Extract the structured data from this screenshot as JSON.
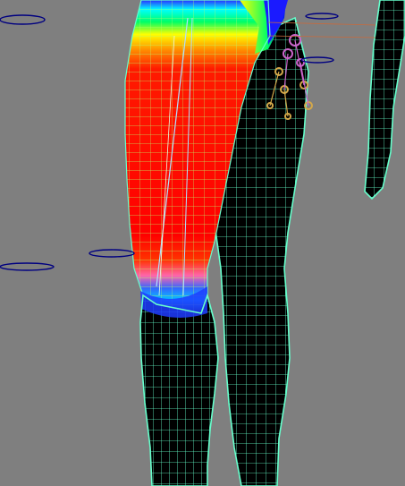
{
  "viewport": {
    "background_color": "#7f7f7f",
    "wire_color": "#66ffcc",
    "joint_color": "#cc66cc",
    "ring_color": "#000080"
  },
  "weight_map": {
    "colors": [
      "#0000ff",
      "#00ffff",
      "#00ff00",
      "#ffff00",
      "#ff8000",
      "#ff0000"
    ]
  }
}
